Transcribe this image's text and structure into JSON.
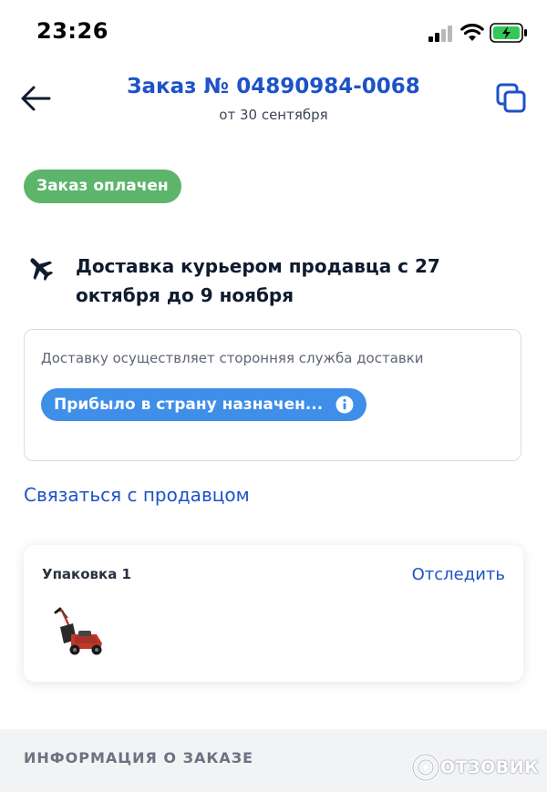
{
  "status_bar": {
    "time": "23:26",
    "icons": [
      "cellular-signal-icon",
      "wifi-icon",
      "battery-charging-icon"
    ]
  },
  "header": {
    "title": "Заказ № 04890984-0068",
    "subtitle": "от 30 сентября",
    "back_icon": "arrow-left-icon",
    "copy_icon": "copy-icon"
  },
  "order_status": {
    "badge": "Заказ оплачен",
    "badge_color": "#5cb56a"
  },
  "delivery": {
    "icon": "airplane-icon",
    "text": "Доставка курьером продавца с 27 октября до 9 ноября"
  },
  "tracking": {
    "note": "Доставку осуществляет сторонняя служба доставки",
    "status": "Прибыло в страну назначен...",
    "status_color": "#3f8ee8",
    "info_icon": "info-icon"
  },
  "contact_seller": "Связаться с продавцом",
  "package": {
    "title": "Упаковка 1",
    "track_label": "Отследить",
    "item_icon": "lawn-mower-image"
  },
  "info_section": {
    "title": "ИНФОРМАЦИЯ О ЗАКАЗЕ"
  },
  "watermark": {
    "text": "ОТЗОВИК"
  },
  "colors": {
    "accent": "#1e52c8",
    "text": "#0f1b2e",
    "muted": "#5e6674"
  }
}
